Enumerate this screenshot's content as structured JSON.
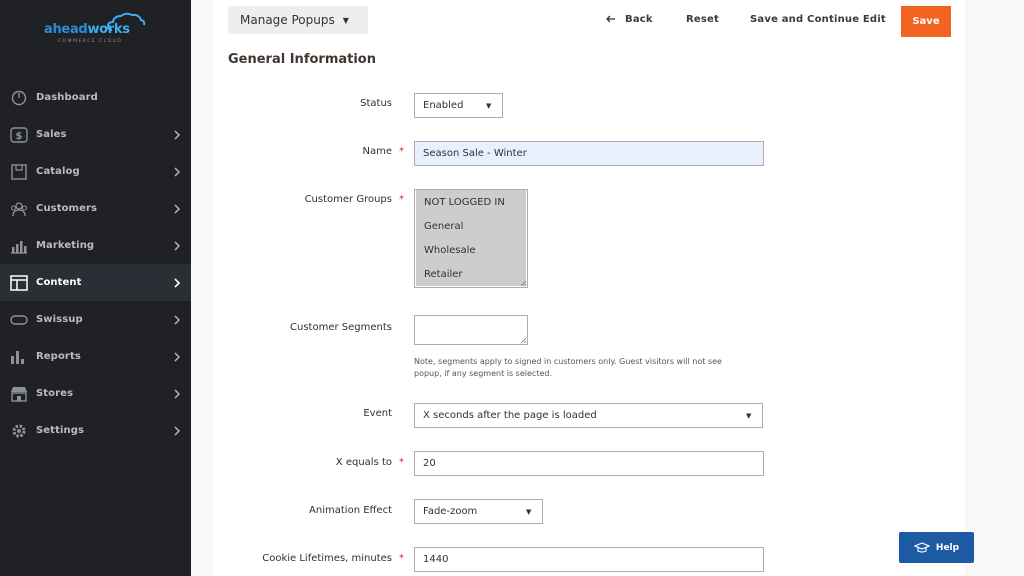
{
  "brand": {
    "name_part1": "ahead",
    "name_part2": "works",
    "tagline": "COMMERCE CLOUD"
  },
  "sidebar": {
    "items": [
      {
        "label": "Dashboard",
        "icon": "dashboard-icon"
      },
      {
        "label": "Sales",
        "icon": "dollar-icon"
      },
      {
        "label": "Catalog",
        "icon": "box-icon"
      },
      {
        "label": "Customers",
        "icon": "users-icon"
      },
      {
        "label": "Marketing",
        "icon": "megaphone-icon"
      },
      {
        "label": "Content",
        "icon": "layout-icon",
        "active": true
      },
      {
        "label": "Swissup",
        "icon": "pill-icon"
      },
      {
        "label": "Reports",
        "icon": "bar-chart-icon"
      },
      {
        "label": "Stores",
        "icon": "store-icon"
      },
      {
        "label": "Settings",
        "icon": "gear-icon"
      }
    ]
  },
  "toolbar": {
    "manage_label": "Manage Popups",
    "back_label": "Back",
    "reset_label": "Reset",
    "save_continue_label": "Save and Continue Edit",
    "save_label": "Save"
  },
  "section": {
    "title": "General Information"
  },
  "form": {
    "status": {
      "label": "Status",
      "value": "Enabled"
    },
    "name": {
      "label": "Name",
      "value": "Season Sale - Winter",
      "required": true
    },
    "customer_groups": {
      "label": "Customer Groups",
      "required": true,
      "options": [
        "NOT LOGGED IN",
        "General",
        "Wholesale",
        "Retailer"
      ]
    },
    "customer_segments": {
      "label": "Customer Segments",
      "note_line1": "Note, segments apply to signed in customers only. Guest visitors will not see",
      "note_line2": "popup, if any segment is selected."
    },
    "event": {
      "label": "Event",
      "value": "X seconds after the page is loaded"
    },
    "x_equals": {
      "label": "X equals to",
      "value": "20",
      "required": true
    },
    "animation": {
      "label": "Animation Effect",
      "value": "Fade-zoom"
    },
    "cookie": {
      "label": "Cookie Lifetimes, minutes",
      "value": "1440",
      "required": true
    }
  },
  "help": {
    "label": "Help"
  },
  "colors": {
    "sidebar_bg": "#1f2125",
    "accent": "#f26322",
    "help_bg": "#1d5aa4",
    "selected_option": "#cdcdcd",
    "name_field_bg": "#e8f0fe"
  }
}
